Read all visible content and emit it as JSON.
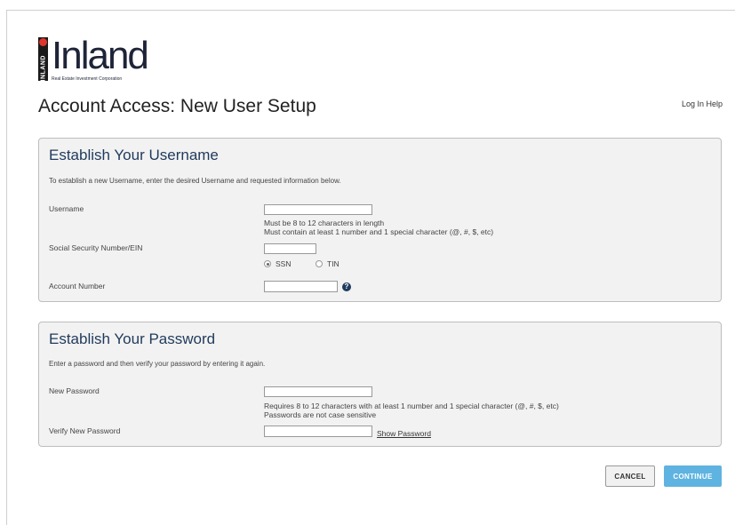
{
  "brand": {
    "logo_word": "Inland",
    "logo_vertical_text": "INLAND",
    "logo_tagline": "Real Estate Investment Corporation",
    "accent_color": "#e0352b",
    "navy_color": "#1f3a5c"
  },
  "header": {
    "title": "Account Access: New User Setup",
    "help_link": "Log In Help"
  },
  "username_section": {
    "heading": "Establish Your Username",
    "intro": "To establish a new Username, enter the desired Username and requested information below.",
    "username_label": "Username",
    "username_value": "",
    "username_hint_1": "Must be 8 to 12 characters in length",
    "username_hint_2": "Must contain at least 1 number and 1 special character (@, #, $, etc)",
    "ssn_label": "Social Security Number/EIN",
    "ssn_value": "",
    "radio_ssn": "SSN",
    "radio_tin": "TIN",
    "selected_id_type": "SSN",
    "account_label": "Account Number",
    "account_value": "",
    "help_icon": "question-mark-icon"
  },
  "password_section": {
    "heading": "Establish Your Password",
    "intro": "Enter a password and then verify your password by entering it again.",
    "new_password_label": "New Password",
    "new_password_value": "",
    "password_hint_1": "Requires 8 to 12 characters with at least 1 number and 1 special character (@, #, $, etc)",
    "password_hint_2": "Passwords are not case sensitive",
    "verify_password_label": "Verify New Password",
    "verify_password_value": "",
    "show_password": "Show Password"
  },
  "actions": {
    "cancel": "CANCEL",
    "continue": "CONTINUE",
    "continue_color": "#5fb3e0"
  }
}
